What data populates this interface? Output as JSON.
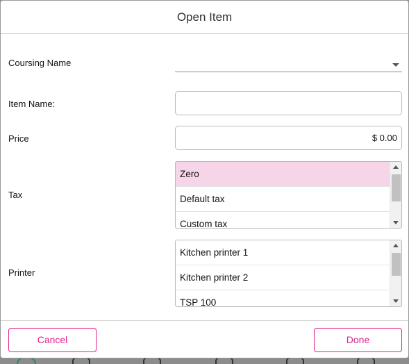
{
  "dialog": {
    "title": "Open Item"
  },
  "form": {
    "coursing_label": "Coursing Name",
    "coursing_value": "",
    "item_name_label": "Item Name:",
    "item_name_value": "",
    "price_label": "Price",
    "price_value": "$ 0.00",
    "tax_label": "Tax",
    "tax_options": [
      "Zero",
      "Default tax",
      "Custom tax"
    ],
    "tax_selected": "Zero",
    "printer_label": "Printer",
    "printer_options": [
      "Kitchen printer 1",
      "Kitchen printer 2",
      "TSP 100"
    ]
  },
  "footer": {
    "cancel_label": "Cancel",
    "done_label": "Done"
  },
  "colors": {
    "accent": "#e0238c",
    "selected_row": "#f7d5e8"
  },
  "icons": {
    "dropdown": "chevron-down-icon",
    "scroll_up": "arrow-up-icon",
    "scroll_down": "arrow-down-icon"
  }
}
